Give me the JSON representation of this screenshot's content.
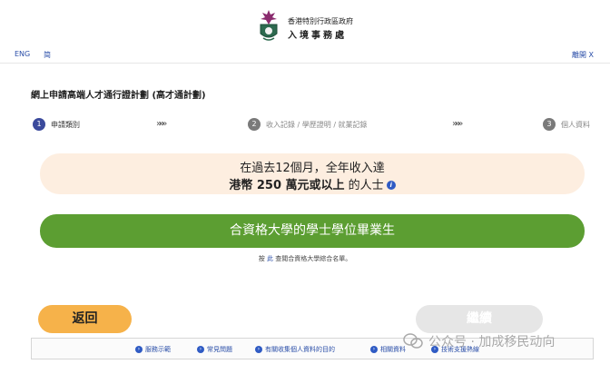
{
  "header": {
    "dept_line1": "香港特別行政區政府",
    "dept_line2": "入境事務處"
  },
  "langbar": {
    "eng": "ENG",
    "sc": "简",
    "leave": "離開 X"
  },
  "page_title": "網上申請高端人才通行證計劃 (高才通計劃)",
  "steps": [
    {
      "num": "1",
      "label": "申請類別"
    },
    {
      "num": "2",
      "label": "收入記錄 / 學歷證明 / 就業記錄"
    },
    {
      "num": "3",
      "label": "個人資料"
    }
  ],
  "step_separator": "»»»",
  "income": {
    "line1": "在過去12個月，全年收入達",
    "line2_bold": "港幣 250 萬元或以上",
    "line2_rest": " 的人士",
    "info_icon": "i"
  },
  "degree_button": "合資格大學的學士學位畢業生",
  "list_note": {
    "pre": "按",
    "link": "此",
    "post": "查閱合資格大學綜合名單。"
  },
  "buttons": {
    "back": "返回",
    "continue": "繼續"
  },
  "footer": {
    "links": [
      "服務示範",
      "常見問題",
      "有關收集個人資料的目的",
      "相關資料",
      "技術支援熱線"
    ]
  },
  "watermark": "公众号 · 加成移民动向",
  "colors": {
    "step_active": "#3b4a9c",
    "degree_green": "#5c9e32",
    "back_orange": "#f6b24a",
    "income_bg": "#fdeee0",
    "link_blue": "#2a4ea8"
  }
}
